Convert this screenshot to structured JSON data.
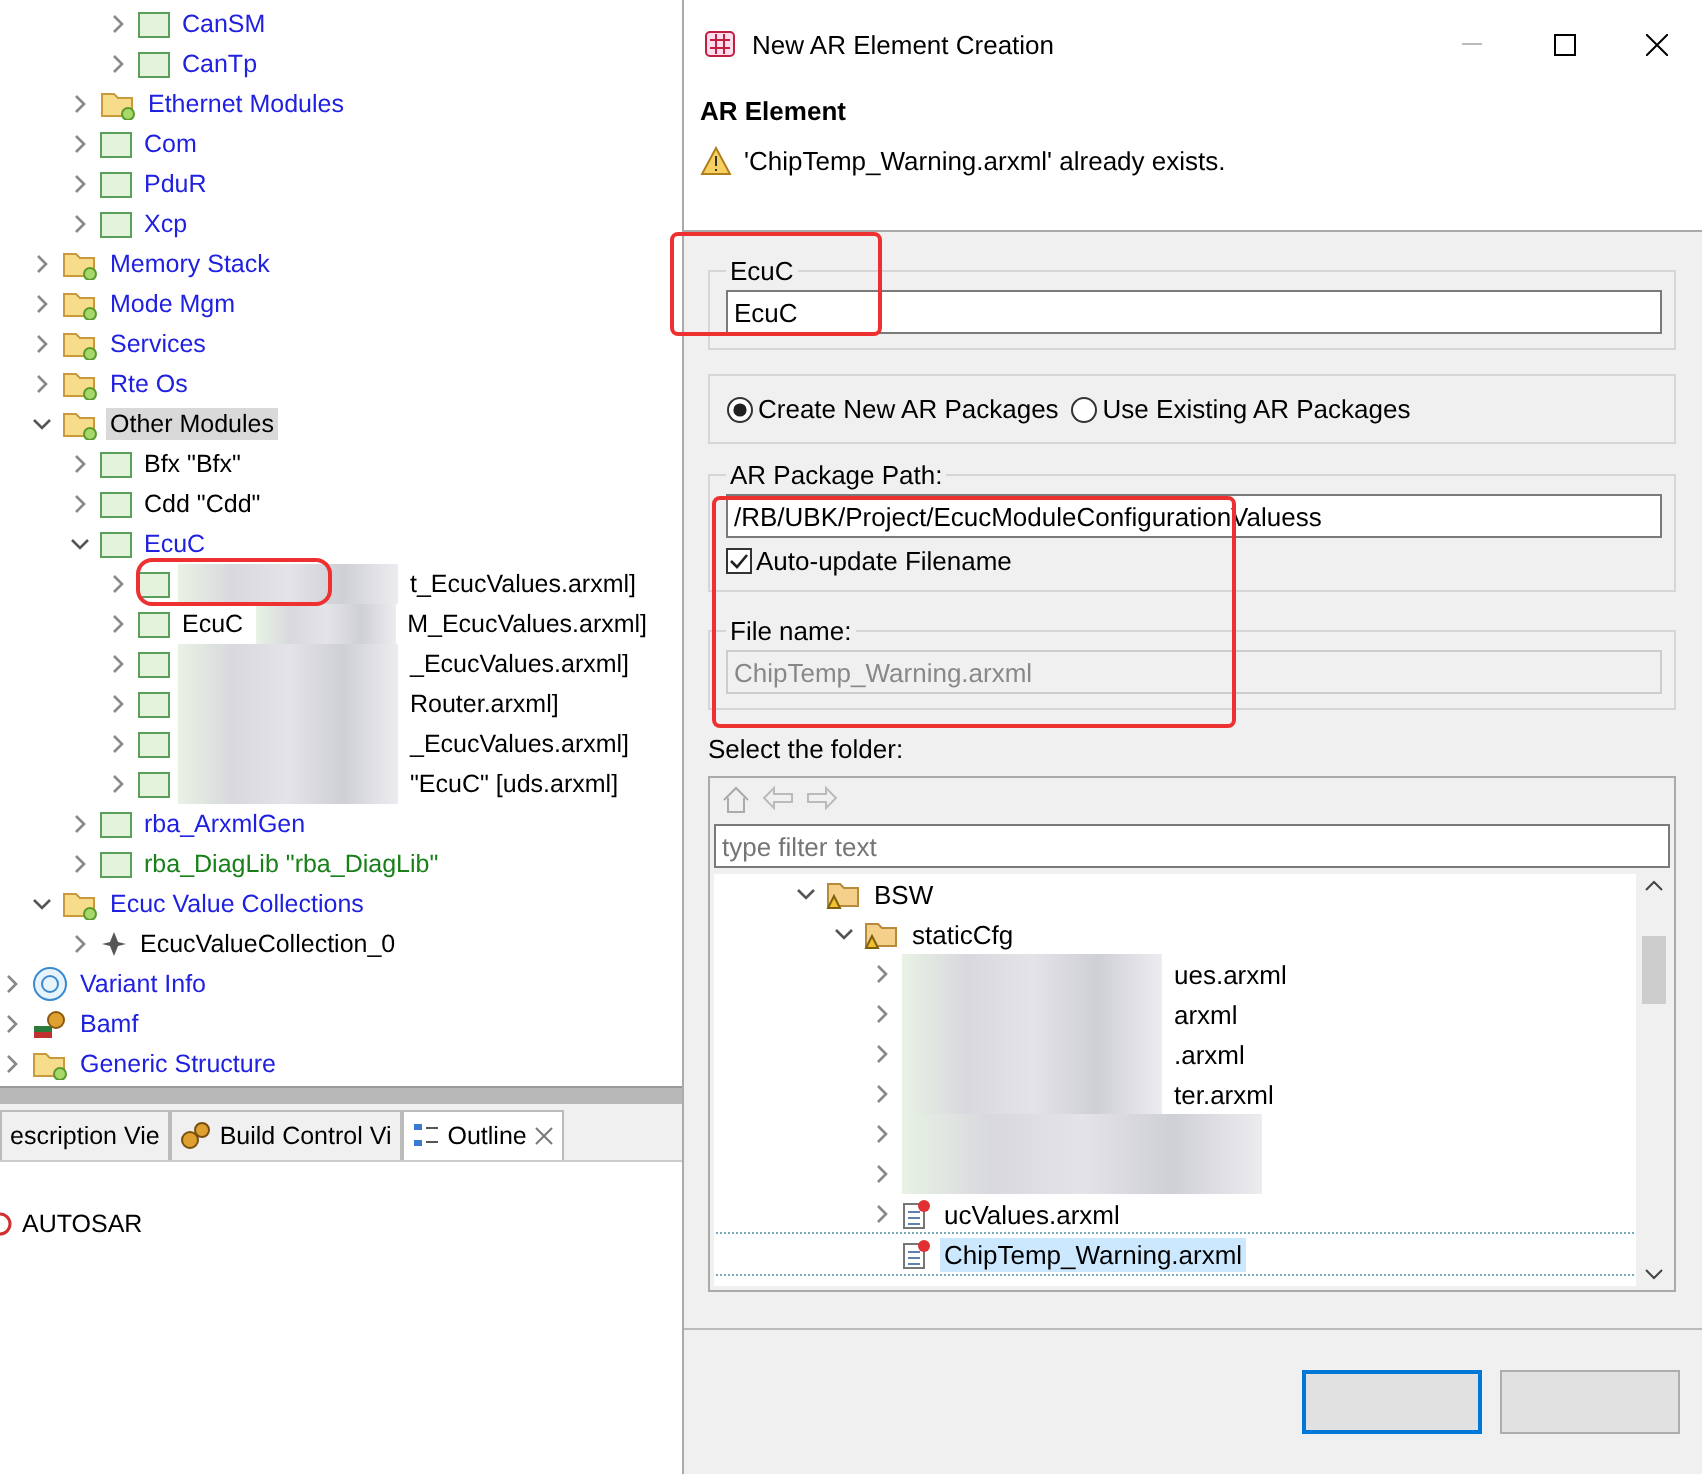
{
  "tree": [
    {
      "children": [
        {
          "children": [
            {
              "children": [
                {
                  "label": "CanSM",
                  "kind": "module",
                  "color": "#2020e0",
                  "expanded": false
                },
                {
                  "label": "CanTp",
                  "kind": "module",
                  "color": "#2020e0",
                  "expanded": false
                }
              ]
            },
            {
              "label": "Ethernet Modules",
              "kind": "folder",
              "color": "#2020e0",
              "expanded": false
            },
            {
              "label": "Com",
              "kind": "module",
              "color": "#2020e0",
              "expanded": false
            },
            {
              "label": "PduR",
              "kind": "module",
              "color": "#2020e0",
              "expanded": false
            },
            {
              "label": "Xcp",
              "kind": "module",
              "color": "#2020e0",
              "expanded": false
            }
          ]
        },
        {
          "label": "Memory Stack",
          "kind": "folder",
          "color": "#2020e0",
          "expanded": false
        },
        {
          "label": "Mode Mgm",
          "kind": "folder",
          "color": "#2020e0",
          "expanded": false
        },
        {
          "label": "Services",
          "kind": "folder",
          "color": "#2020e0",
          "expanded": false
        },
        {
          "label": "Rte Os",
          "kind": "folder",
          "color": "#2020e0",
          "expanded": false
        },
        {
          "label": "Other Modules",
          "kind": "folder",
          "color": "#000000",
          "expanded": true,
          "selected": true,
          "children": [
            {
              "label": "Bfx \"Bfx\"",
              "kind": "module",
              "color": "#000000",
              "expanded": false
            },
            {
              "label": "Cdd \"Cdd\"",
              "kind": "module",
              "color": "#000000",
              "expanded": false
            },
            {
              "label": "EcuC",
              "kind": "module",
              "color": "#2020e0",
              "expanded": true,
              "children": [
                {
                  "label": "t_EcucValues.arxml]",
                  "kind": "redacted",
                  "color": "#000000",
                  "expanded": false
                },
                {
                  "prefix": "EcuC",
                  "label": "M_EcucValues.arxml]",
                  "kind": "redacted",
                  "color": "#000000",
                  "expanded": false
                },
                {
                  "label": "_EcucValues.arxml]",
                  "kind": "redacted",
                  "color": "#000000",
                  "expanded": false
                },
                {
                  "label": "Router.arxml]",
                  "kind": "redacted",
                  "color": "#000000",
                  "expanded": false
                },
                {
                  "label": "_EcucValues.arxml]",
                  "kind": "redacted",
                  "color": "#000000",
                  "expanded": false
                },
                {
                  "label": "\"EcuC\" [uds.arxml]",
                  "kind": "redacted",
                  "color": "#000000",
                  "expanded": false
                }
              ]
            },
            {
              "label": "rba_ArxmlGen",
              "kind": "module",
              "color": "#2020e0",
              "expanded": false
            },
            {
              "label": "rba_DiagLib \"rba_DiagLib\"",
              "kind": "module",
              "color": "#188018",
              "expanded": false
            }
          ]
        },
        {
          "label": "Ecuc Value Collections",
          "kind": "folder",
          "color": "#2020e0",
          "expanded": true,
          "children": [
            {
              "label": "EcucValueCollection_0",
              "kind": "collection",
              "color": "#000000",
              "expanded": false
            }
          ]
        }
      ]
    },
    {
      "label": "Variant Info",
      "kind": "variant",
      "color": "#2020e0",
      "expanded": false
    },
    {
      "label": "Bamf",
      "kind": "bamf",
      "color": "#2020e0",
      "expanded": false
    },
    {
      "label": "Generic Structure",
      "kind": "folder",
      "color": "#2020e0",
      "expanded": false
    }
  ],
  "bottom_tabs": [
    {
      "label": "escription Vie",
      "kind": "plain",
      "selected": false
    },
    {
      "label": "Build Control Vi",
      "kind": "gears",
      "selected": false
    },
    {
      "label": "Outline",
      "kind": "outline",
      "selected": true
    }
  ],
  "outline_items": [
    {
      "label": "AUTOSAR"
    }
  ],
  "dialog": {
    "title": "New AR Element Creation",
    "header": "AR Element",
    "warning": "'ChipTemp_Warning.arxml' already exists.",
    "name_group": {
      "label": "EcuC",
      "value": "EcuC"
    },
    "package_options": [
      {
        "label": "Create New AR Packages",
        "selected": true
      },
      {
        "label": "Use Existing AR Packages",
        "selected": false
      }
    ],
    "package_path": {
      "label": "AR Package Path:",
      "value": "/RB/UBK/Project/EcucModuleConfigurationValuess"
    },
    "auto_update": {
      "label": "Auto-update Filename",
      "checked": true
    },
    "file_name": {
      "label": "File name:",
      "value": "ChipTemp_Warning.arxml",
      "disabled": true
    },
    "folder_label": "Select the folder:",
    "filter": {
      "placeholder": "type filter text"
    },
    "folders": [
      {
        "label": "BSW",
        "kind": "folder",
        "expanded": true,
        "selected": false,
        "children": [
          {
            "label": "staticCfg",
            "kind": "folder",
            "expanded": true,
            "selected": false,
            "children": [
              {
                "label": "ues.arxml",
                "kind": "redacted",
                "selected": false
              },
              {
                "label": "arxml",
                "kind": "redacted",
                "selected": false
              },
              {
                "label": ".arxml",
                "kind": "redacted",
                "selected": false
              },
              {
                "label": "ter.arxml",
                "kind": "redacted",
                "selected": false
              },
              {
                "kind": "redacted",
                "selected": false
              },
              {
                "kind": "redacted",
                "selected": false
              },
              {
                "label": "ucValues.arxml",
                "kind": "file",
                "selected": false
              },
              {
                "label": "ChipTemp_Warning.arxml",
                "kind": "leaf",
                "selected": true
              }
            ]
          }
        ]
      }
    ],
    "buttons": [
      {
        "default": true
      },
      {
        "default": false
      }
    ]
  }
}
